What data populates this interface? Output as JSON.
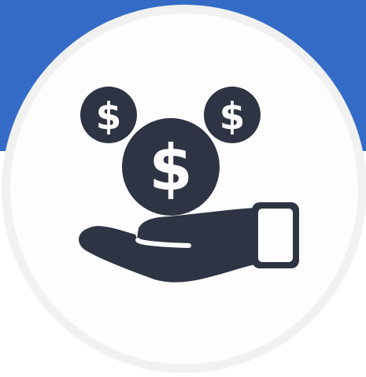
{
  "icon": {
    "name": "money-in-hand-icon",
    "coin_symbol_large": "$",
    "coin_symbol_small_left": "$",
    "coin_symbol_small_right": "$"
  },
  "colors": {
    "top_band": "#346bc7",
    "circle_fill": "#fdfdfd",
    "circle_border": "#f1f1f1",
    "icon_fill": "#2f3444",
    "icon_symbol": "#fdfdfd"
  }
}
